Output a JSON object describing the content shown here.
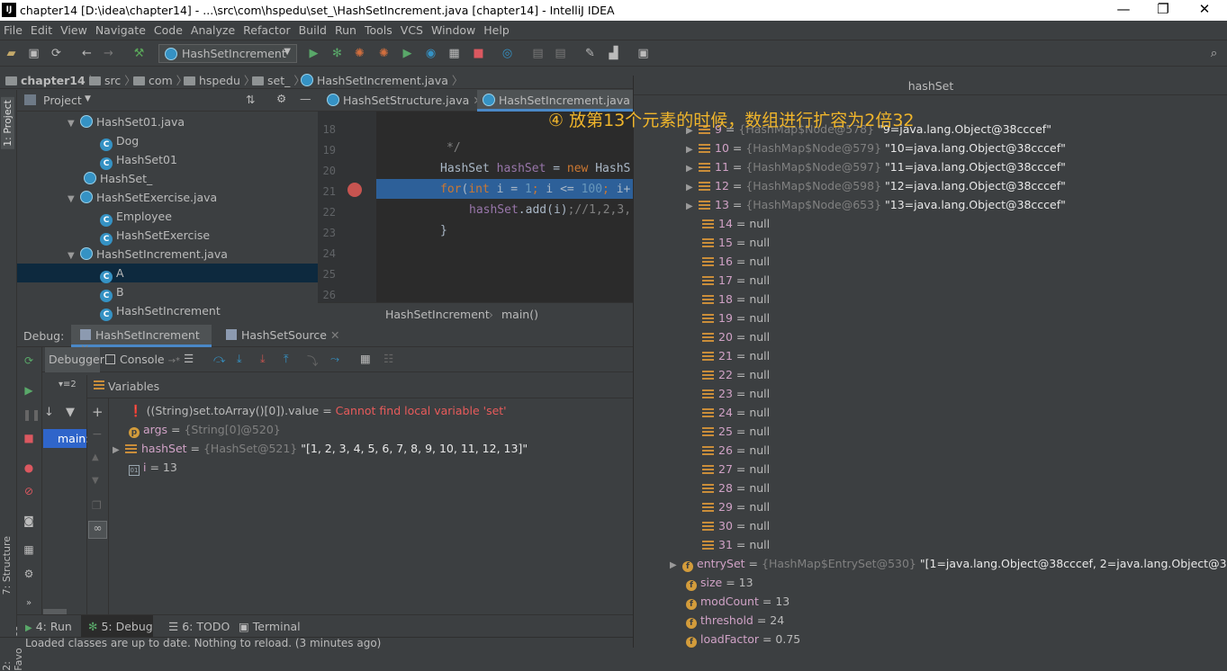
{
  "window": {
    "title": "chapter14 [D:\\idea\\chapter14] - ...\\src\\com\\hspedu\\set_\\HashSetIncrement.java [chapter14] - IntelliJ IDEA",
    "logo": "IJ",
    "minimize": "—",
    "maximize": "❐",
    "close": "✕"
  },
  "menu": [
    "File",
    "Edit",
    "View",
    "Navigate",
    "Code",
    "Analyze",
    "Refactor",
    "Build",
    "Run",
    "Tools",
    "VCS",
    "Window",
    "Help"
  ],
  "toolbar": {
    "run_config": "HashSetIncrement"
  },
  "nav": {
    "crumbs": [
      "chapter14",
      "src",
      "com",
      "hspedu",
      "set_",
      "HashSetIncrement.java"
    ]
  },
  "left_tabs": {
    "project": "1: Project",
    "structure": "7: Structure",
    "favorites": "2: Favorites"
  },
  "project": {
    "title": "Project",
    "tree": [
      {
        "label": "HashSet01.java",
        "kind": "file",
        "indent": 1,
        "expanded": true
      },
      {
        "label": "Dog",
        "kind": "class",
        "indent": 2
      },
      {
        "label": "HashSet01",
        "kind": "class",
        "indent": 2
      },
      {
        "label": "HashSet_",
        "kind": "file",
        "indent": 1
      },
      {
        "label": "HashSetExercise.java",
        "kind": "file",
        "indent": 1,
        "expanded": true
      },
      {
        "label": "Employee",
        "kind": "class",
        "indent": 2
      },
      {
        "label": "HashSetExercise",
        "kind": "class",
        "indent": 2
      },
      {
        "label": "HashSetIncrement.java",
        "kind": "file",
        "indent": 1,
        "expanded": true
      },
      {
        "label": "A",
        "kind": "class",
        "indent": 2,
        "selected": true
      },
      {
        "label": "B",
        "kind": "class",
        "indent": 2
      },
      {
        "label": "HashSetIncrement",
        "kind": "class",
        "indent": 2
      }
    ]
  },
  "editor": {
    "tabs": [
      {
        "label": "HashSetStructure.java",
        "active": false
      },
      {
        "label": "HashSetIncrement.java",
        "active": true
      }
    ],
    "line_numbers": [
      "18",
      "19",
      "20",
      "21",
      "22",
      "23",
      "24",
      "25",
      "26"
    ],
    "lines": {
      "l19": "*/",
      "l20_a": "HashSet ",
      "l20_b": "hashSet",
      "l20_c": " = ",
      "l20_d": "new ",
      "l20_e": "HashS",
      "l21_a": "for",
      "l21_b": "(",
      "l21_c": "int ",
      "l21_d": "i",
      "l21_e": " = ",
      "l21_f": "1",
      "l21_g": "; ",
      "l21_h": "i",
      "l21_i": " <= ",
      "l21_j": "100",
      "l21_k": "; ",
      "l21_l": "i+",
      "l22_a": "hashSet",
      "l22_b": ".add(",
      "l22_c": "i",
      "l22_d": ")",
      "l22_e": ";//1,2,3,",
      "l23": "}"
    },
    "breadcrumb": [
      "HashSetIncrement",
      "main()"
    ],
    "annotation": "④ 放第13个元素的时候，数组进行扩容为2倍32"
  },
  "debug": {
    "label": "Debug:",
    "tabs": [
      "HashSetIncrement",
      "HashSetSource"
    ],
    "subtabs": {
      "debugger": "Debugger",
      "console": "Console"
    },
    "frames_label": "main:",
    "variables_title": "Variables",
    "vars": [
      {
        "name": "((String)set.toArray()[0]).value",
        "eq": " = ",
        "value": "Cannot find local variable 'set'",
        "kind": "error"
      },
      {
        "name": "args",
        "eq": " = ",
        "value": "{String[0]@520}",
        "kind": "param"
      },
      {
        "name": "hashSet",
        "eq": " = ",
        "type": "{HashSet@521}",
        "value": "\"[1, 2, 3, 4, 5, 6, 7, 8, 9, 10, 11, 12, 13]\"",
        "kind": "field"
      },
      {
        "name": "i",
        "eq": " = ",
        "value": "13",
        "kind": "local"
      }
    ]
  },
  "popup": {
    "title": "hashSet",
    "table_rows": [
      {
        "idx": "9",
        "type": "{HashMap$Node@578}",
        "val": "\"9=java.lang.Object@38cccef\""
      },
      {
        "idx": "10",
        "type": "{HashMap$Node@579}",
        "val": "\"10=java.lang.Object@38cccef\""
      },
      {
        "idx": "11",
        "type": "{HashMap$Node@597}",
        "val": "\"11=java.lang.Object@38cccef\""
      },
      {
        "idx": "12",
        "type": "{HashMap$Node@598}",
        "val": "\"12=java.lang.Object@38cccef\""
      },
      {
        "idx": "13",
        "type": "{HashMap$Node@653}",
        "val": "\"13=java.lang.Object@38cccef\""
      }
    ],
    "null_rows": [
      "14",
      "15",
      "16",
      "17",
      "18",
      "19",
      "20",
      "21",
      "22",
      "23",
      "24",
      "25",
      "26",
      "27",
      "28",
      "29",
      "30",
      "31"
    ],
    "null_text": "null",
    "eq": " = ",
    "fields": [
      {
        "name": "entrySet",
        "type": "{HashMap$EntrySet@530}",
        "val": "\"[1=java.lang.Object@38cccef, 2=java.lang.Object@38cccef, 3=",
        "expandable": true
      },
      {
        "name": "size",
        "val": "13"
      },
      {
        "name": "modCount",
        "val": "13"
      },
      {
        "name": "threshold",
        "val": "24"
      },
      {
        "name": "loadFactor",
        "val": "0.75"
      }
    ]
  },
  "bottom_tabs": [
    {
      "label": "4: Run",
      "icon": "▶"
    },
    {
      "label": "5: Debug",
      "icon": "✻"
    },
    {
      "label": "6: TODO",
      "icon": "☰"
    },
    {
      "label": "Terminal",
      "icon": "▣"
    }
  ],
  "status": "Loaded classes are up to date. Nothing to reload. (3 minutes ago)",
  "colors": {
    "accent": "#3592c4",
    "selection": "#0d293e",
    "annotation": "#f0b52b",
    "error": "#e85b5b"
  }
}
